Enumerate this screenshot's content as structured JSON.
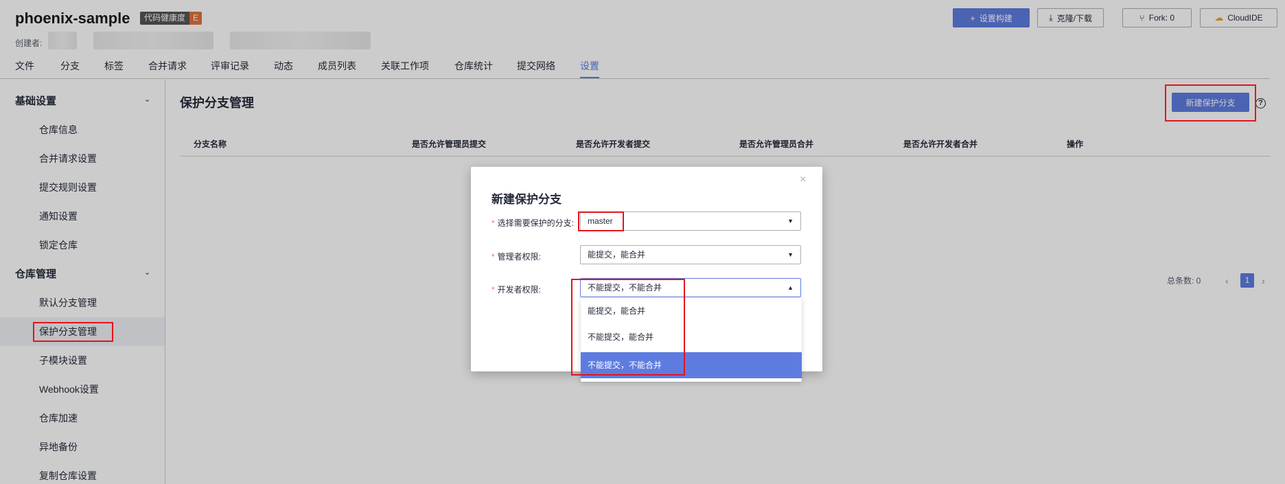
{
  "header": {
    "repo_name": "phoenix-sample",
    "health_badge": {
      "label": "代码健康度",
      "grade": "E"
    },
    "creator_label": "创建者:",
    "buttons": {
      "build": "设置构建",
      "clone": "克隆/下载",
      "fork": "Fork: 0",
      "cloudide": "CloudIDE"
    },
    "tabs": [
      "文件",
      "分支",
      "标签",
      "合并请求",
      "评审记录",
      "动态",
      "成员列表",
      "关联工作项",
      "仓库统计",
      "提交网络",
      "设置"
    ],
    "active_tab": "设置"
  },
  "sidebar": {
    "group1": "基础设置",
    "group1_items": [
      "仓库信息",
      "合并请求设置",
      "提交规则设置",
      "通知设置",
      "锁定仓库"
    ],
    "group2": "仓库管理",
    "group2_items": [
      "默认分支管理",
      "保护分支管理",
      "子模块设置",
      "Webhook设置",
      "仓库加速",
      "异地备份",
      "复制仓库设置"
    ],
    "active_item": "保护分支管理"
  },
  "main": {
    "title": "保护分支管理",
    "new_button": "新建保护分支",
    "help_icon": "?",
    "columns": [
      "分支名称",
      "是否允许管理员提交",
      "是否允许开发者提交",
      "是否允许管理员合并",
      "是否允许开发者合并",
      "操作"
    ],
    "pager": {
      "total": "总条数: 0",
      "page": "1",
      "prev": "‹",
      "next": "›"
    }
  },
  "modal": {
    "title": "新建保护分支",
    "close": "×",
    "fields": {
      "branch": {
        "label": "选择需要保护的分支:",
        "value": "master"
      },
      "admin": {
        "label": "管理者权限:",
        "value": "能提交，能合并"
      },
      "developer": {
        "label": "开发者权限:",
        "value": "不能提交，不能合并"
      }
    },
    "dropdown_options": [
      "能提交，能合并",
      "不能提交，能合并",
      "不能提交，不能合并"
    ],
    "selected_option": "不能提交，不能合并"
  },
  "colors": {
    "primary": "#5e7ce0",
    "annotation_red": "#e4141d",
    "badge_grade": "#e0743c"
  }
}
